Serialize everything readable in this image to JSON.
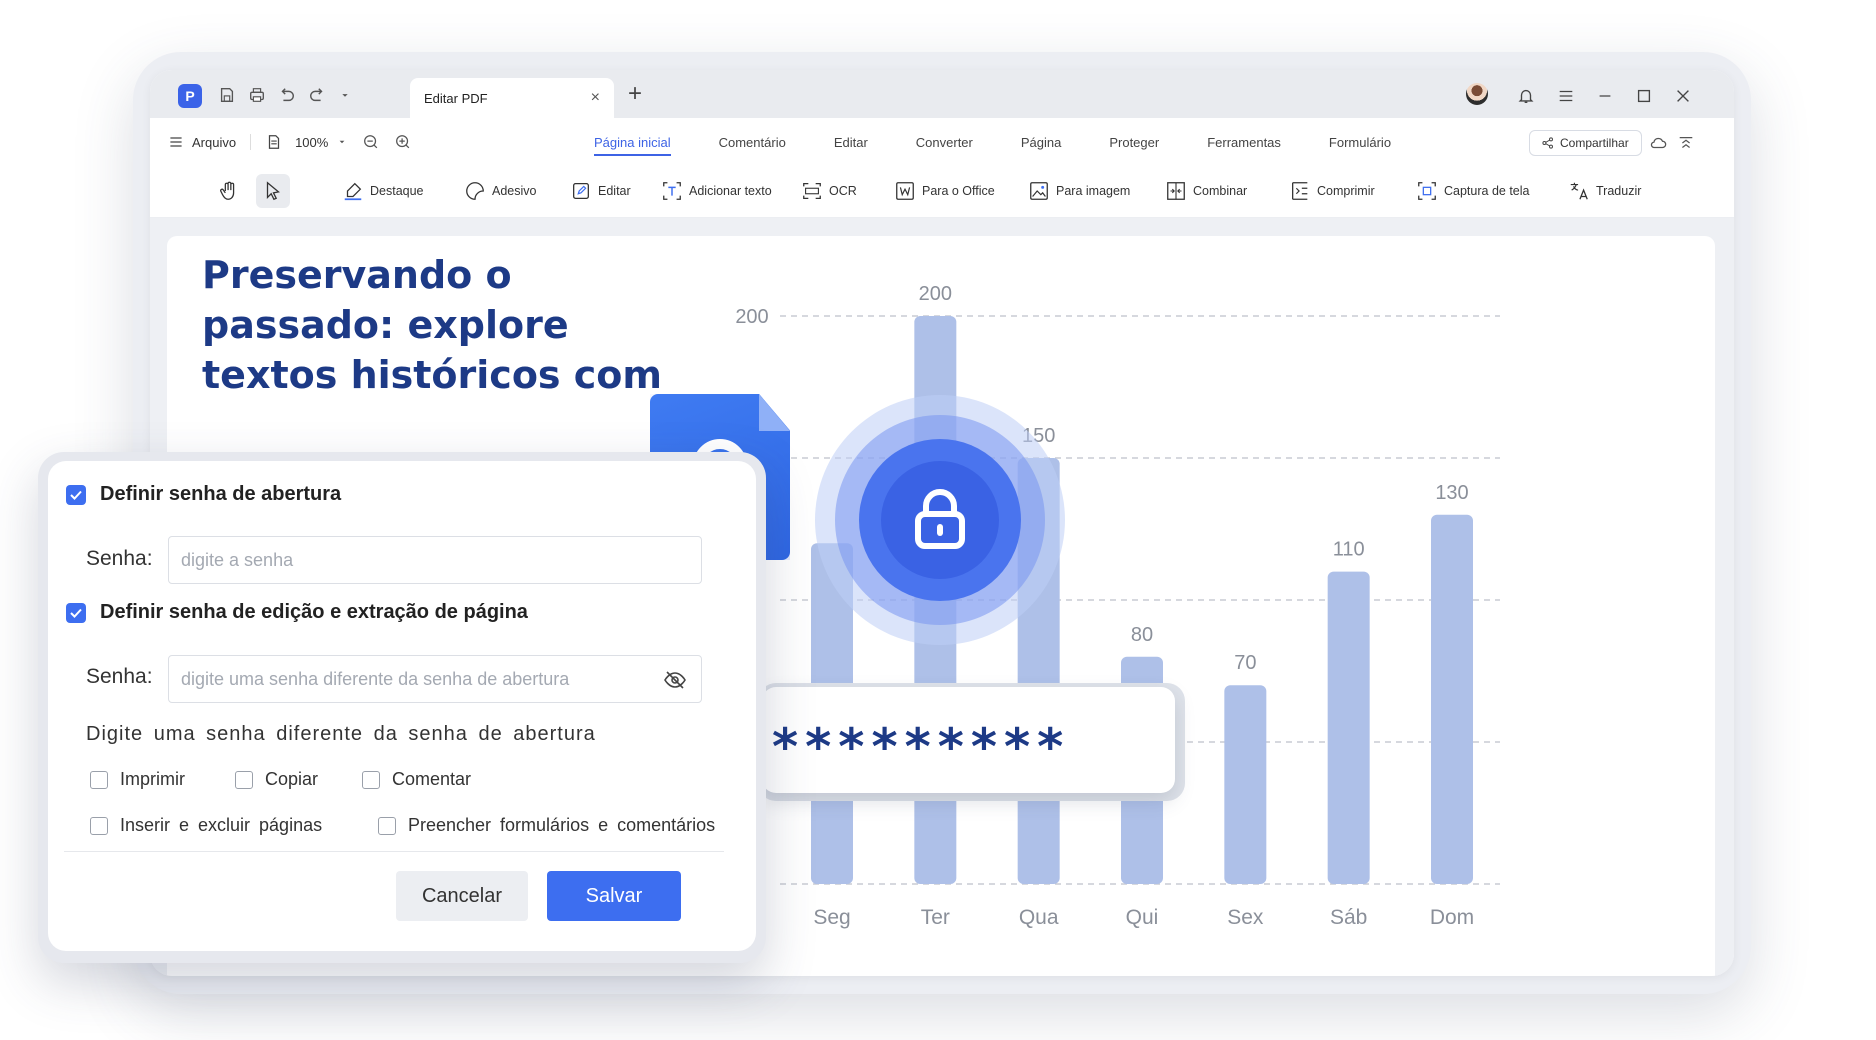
{
  "titlebar": {
    "tab_label": "Editar PDF",
    "tab_close": "×",
    "new_tab": "+"
  },
  "menu": {
    "file": "Arquivo",
    "zoom": "100%",
    "tabs": [
      "Página inicial",
      "Comentário",
      "Editar",
      "Converter",
      "Página",
      "Proteger",
      "Ferramentas",
      "Formulário"
    ],
    "share": "Compartilhar"
  },
  "toolbar": {
    "tools": [
      "Destaque",
      "Adesivo",
      "Editar",
      "Adicionar texto",
      "OCR",
      "Para o Office",
      "Para imagem",
      "Combinar",
      "Comprimir",
      "Captura de tela",
      "Traduzir"
    ]
  },
  "document": {
    "title": "Preservando o passado: explore textos históricos com"
  },
  "chart_data": {
    "type": "bar",
    "categories": [
      "Seg",
      "Ter",
      "Qua",
      "Qui",
      "Sex",
      "Sáb",
      "Dom"
    ],
    "values": [
      120,
      200,
      150,
      80,
      70,
      110,
      130
    ],
    "value_labels": [
      "",
      "200",
      "150",
      "80",
      "70",
      "110",
      "130"
    ],
    "ylim": [
      0,
      200
    ],
    "yticks_visible": [
      "200"
    ],
    "grid": "dashed",
    "bar_color": "#aec0e8"
  },
  "password_display": "*********",
  "dialog": {
    "open_pw_label": "Definir senha de abertura",
    "open_pw_checked": true,
    "field_label_1": "Senha:",
    "placeholder_1": "digite a senha",
    "edit_pw_label": "Definir senha de edição e extração de página",
    "edit_pw_checked": true,
    "field_label_2": "Senha:",
    "placeholder_2": "digite uma senha diferente da senha de abertura",
    "hint": "Digite uma senha diferente da senha de abertura",
    "options": [
      "Imprimir",
      "Copiar",
      "Comentar",
      "Inserir e excluir páginas",
      "Preencher formulários e comentários"
    ],
    "cancel": "Cancelar",
    "save": "Salvar"
  },
  "colors": {
    "accent": "#3d6ef0",
    "title_blue": "#1d3a86",
    "bar": "#aec0e8"
  },
  "icons": [
    "app-logo-icon",
    "save-icon",
    "print-icon",
    "undo-icon",
    "redo-icon",
    "dropdown-icon",
    "avatar",
    "bell-icon",
    "menu-icon",
    "minimize-icon",
    "maximize-icon",
    "close-icon",
    "hand-icon",
    "cursor-icon",
    "lock-icon",
    "eye-off-icon"
  ]
}
